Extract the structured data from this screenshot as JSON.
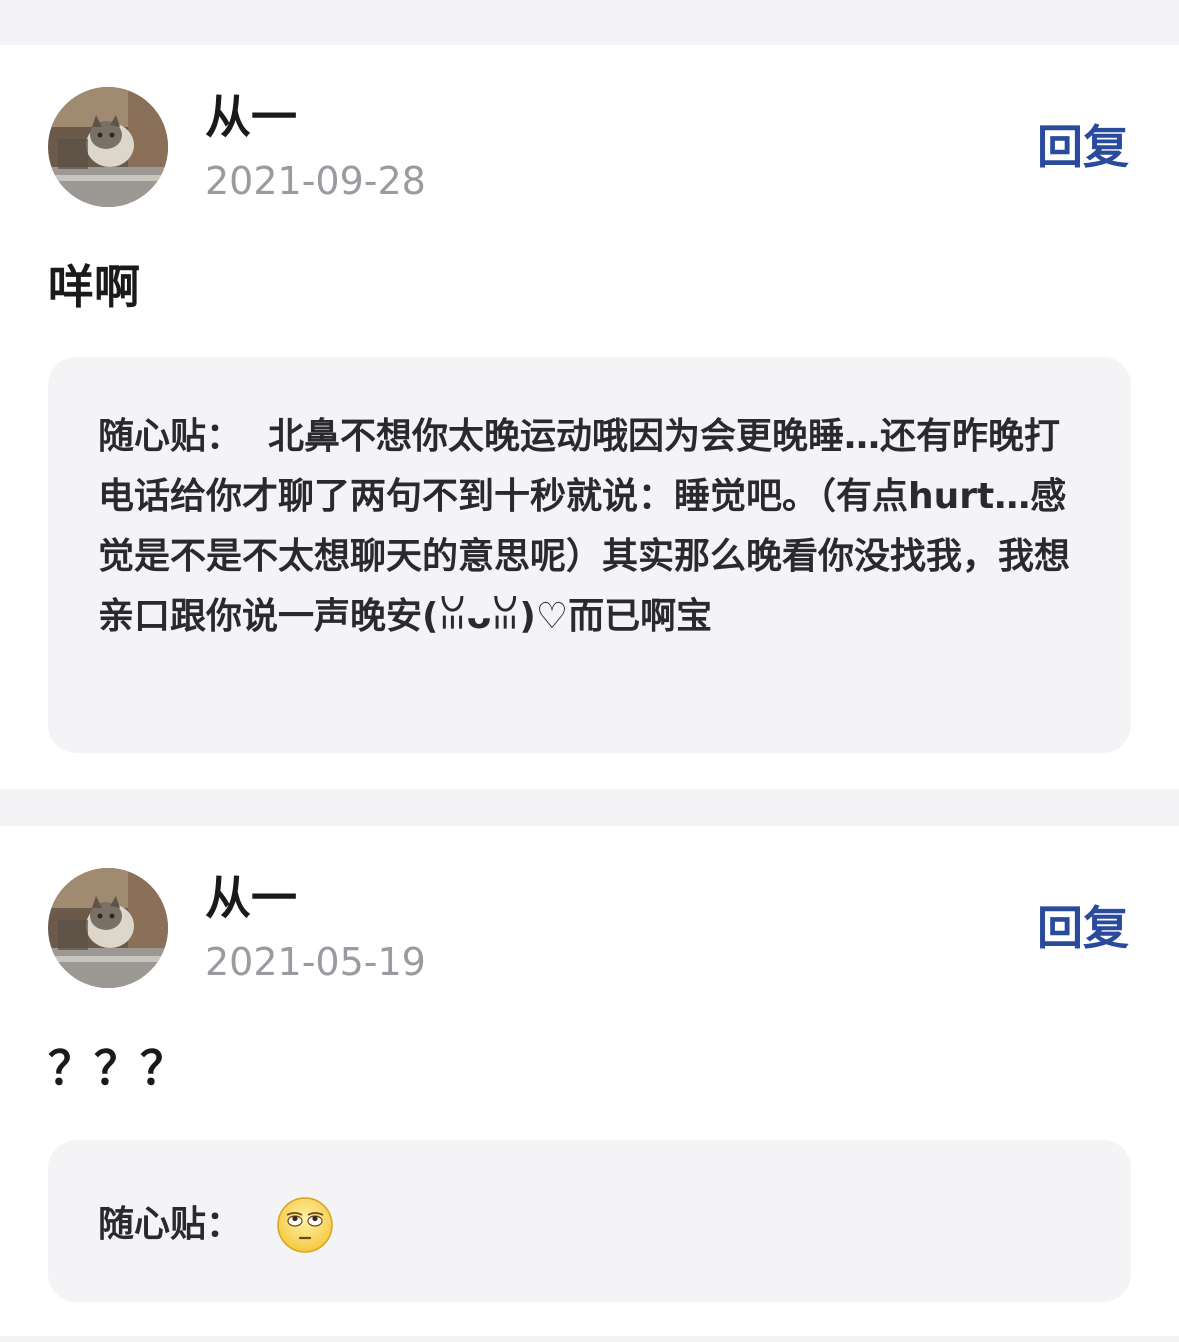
{
  "comments": [
    {
      "username": "从一",
      "date": "2021-09-28",
      "reply_label": "回复",
      "text": "咩啊",
      "note_label": "随心贴：",
      "note_text": "北鼻不想你太晚运动哦因为会更晚睡…还有昨晚打电话给你才聊了两句不到十秒就说：睡觉吧。（有点hurt…感觉是不是不太想聊天的意思呢）其实那么晚看你没找我，我想亲口跟你说一声晚安(ꈍᴗꈍ)♡而已啊宝"
    },
    {
      "username": "从一",
      "date": "2021-05-19",
      "reply_label": "回复",
      "text": "？？？",
      "note_label": "随心贴：",
      "note_icon": "eye-roll-emoji-icon"
    }
  ],
  "colors": {
    "page_bg": "#f4f4f6",
    "card_bg": "#ffffff",
    "note_bg": "#f4f4f6",
    "reply_accent": "#2a4a9c",
    "date_gray": "#9a9aa0",
    "text_dark": "#1a1a1a"
  }
}
